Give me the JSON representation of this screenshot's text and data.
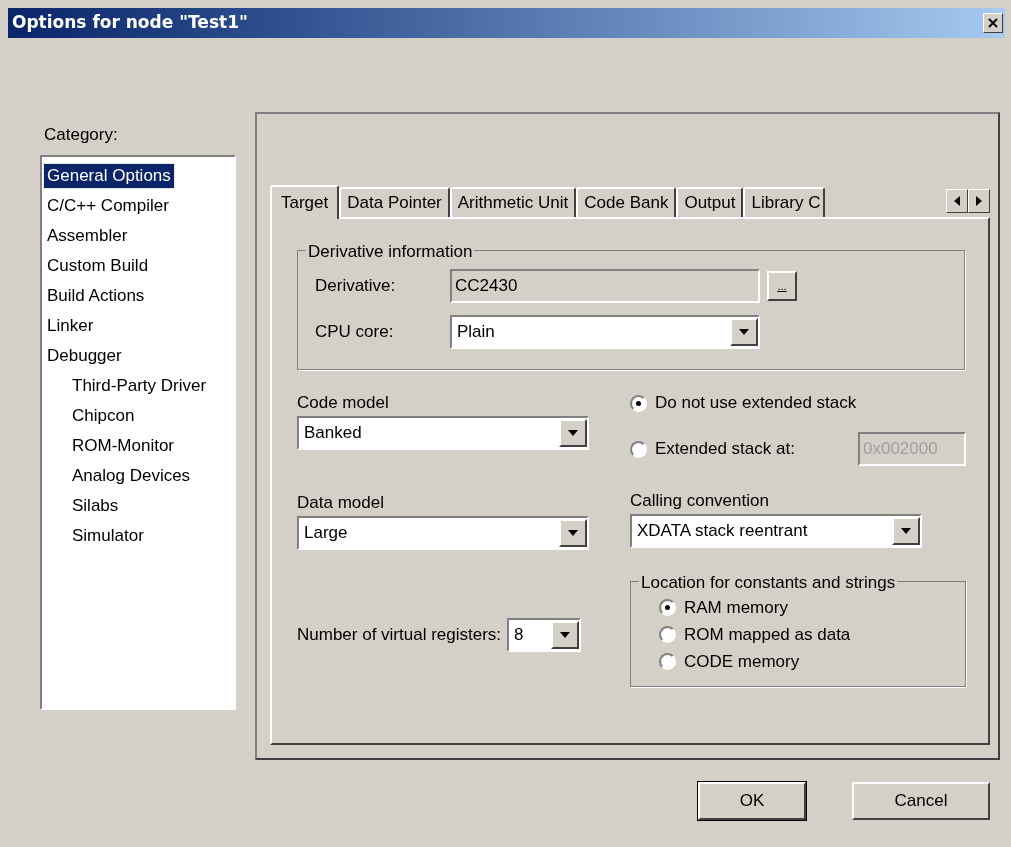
{
  "window": {
    "title": "Options for node \"Test1\""
  },
  "category": {
    "label": "Category:",
    "items": [
      {
        "label": "General Options",
        "selected": true
      },
      {
        "label": "C/C++ Compiler",
        "selected": false
      },
      {
        "label": "Assembler",
        "selected": false
      },
      {
        "label": "Custom Build",
        "selected": false
      },
      {
        "label": "Build Actions",
        "selected": false
      },
      {
        "label": "Linker",
        "selected": false
      },
      {
        "label": "Debugger",
        "selected": false,
        "children": [
          {
            "label": "Third-Party Driver",
            "selected": false
          },
          {
            "label": "Chipcon",
            "selected": false
          },
          {
            "label": "ROM-Monitor",
            "selected": false
          },
          {
            "label": "Analog Devices",
            "selected": false
          },
          {
            "label": "Silabs",
            "selected": false
          },
          {
            "label": "Simulator",
            "selected": false
          }
        ]
      }
    ]
  },
  "tabs": [
    {
      "label": "Target",
      "selected": true
    },
    {
      "label": "Data Pointer",
      "selected": false
    },
    {
      "label": "Arithmetic Unit",
      "selected": false
    },
    {
      "label": "Code Bank",
      "selected": false
    },
    {
      "label": "Output",
      "selected": false
    },
    {
      "label": "Library C",
      "selected": false
    }
  ],
  "derivative_group": {
    "title": "Derivative information",
    "derivative": {
      "label": "Derivative:",
      "value": "CC2430"
    },
    "browse_button": "...",
    "cpu_core": {
      "label": "CPU core:",
      "value": "Plain"
    }
  },
  "code_model": {
    "label": "Code model",
    "value": "Banked"
  },
  "stack_options": [
    {
      "label": "Do not use extended stack",
      "selected": true
    },
    {
      "label": "Extended stack at:",
      "selected": false
    }
  ],
  "extended_stack_address": {
    "value": "0x002000",
    "disabled": true
  },
  "data_model": {
    "label": "Data model",
    "value": "Large"
  },
  "calling_convention": {
    "label": "Calling convention",
    "value": "XDATA stack reentrant"
  },
  "virtual_registers": {
    "label": "Number of virtual registers:",
    "value": "8"
  },
  "constants_location": {
    "title": "Location for constants and strings",
    "options": [
      {
        "label": "RAM memory",
        "selected": true
      },
      {
        "label": "ROM mapped as data",
        "selected": false
      },
      {
        "label": "CODE memory",
        "selected": false
      }
    ]
  },
  "buttons": [
    "OK",
    "Cancel"
  ]
}
